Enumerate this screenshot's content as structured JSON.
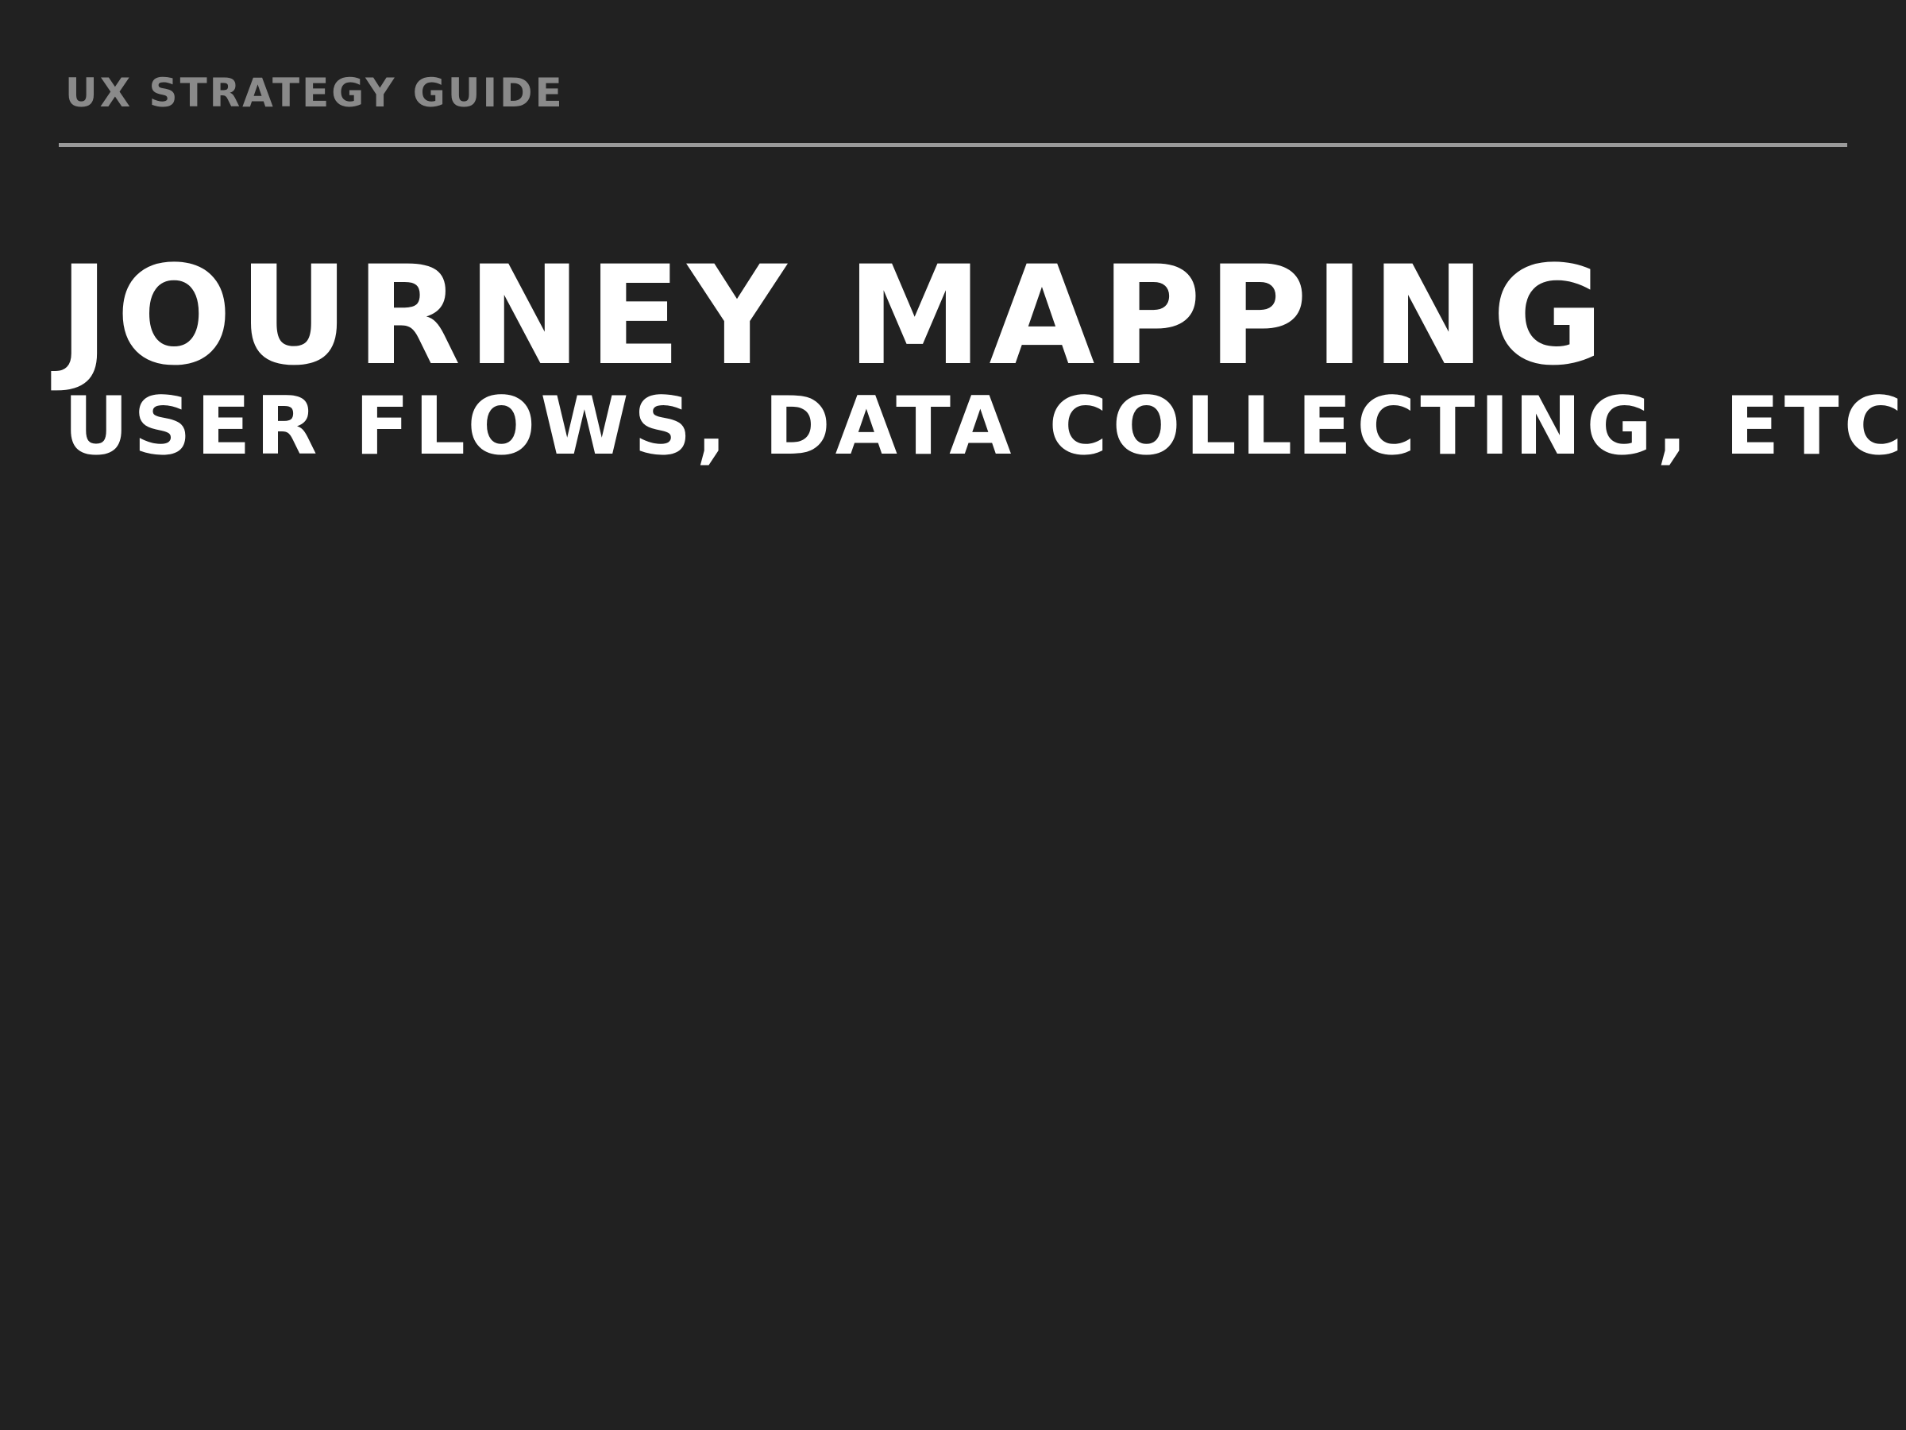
{
  "header": {
    "kicker": "UX STRATEGY GUIDE"
  },
  "content": {
    "title": "JOURNEY MAPPING",
    "subtitle": "USER FLOWS, DATA COLLECTING, ETC"
  },
  "colors": {
    "background": "#212121",
    "kicker_text": "#8a8a8a",
    "rule": "#9a9a9a",
    "title_text": "#ffffff"
  }
}
